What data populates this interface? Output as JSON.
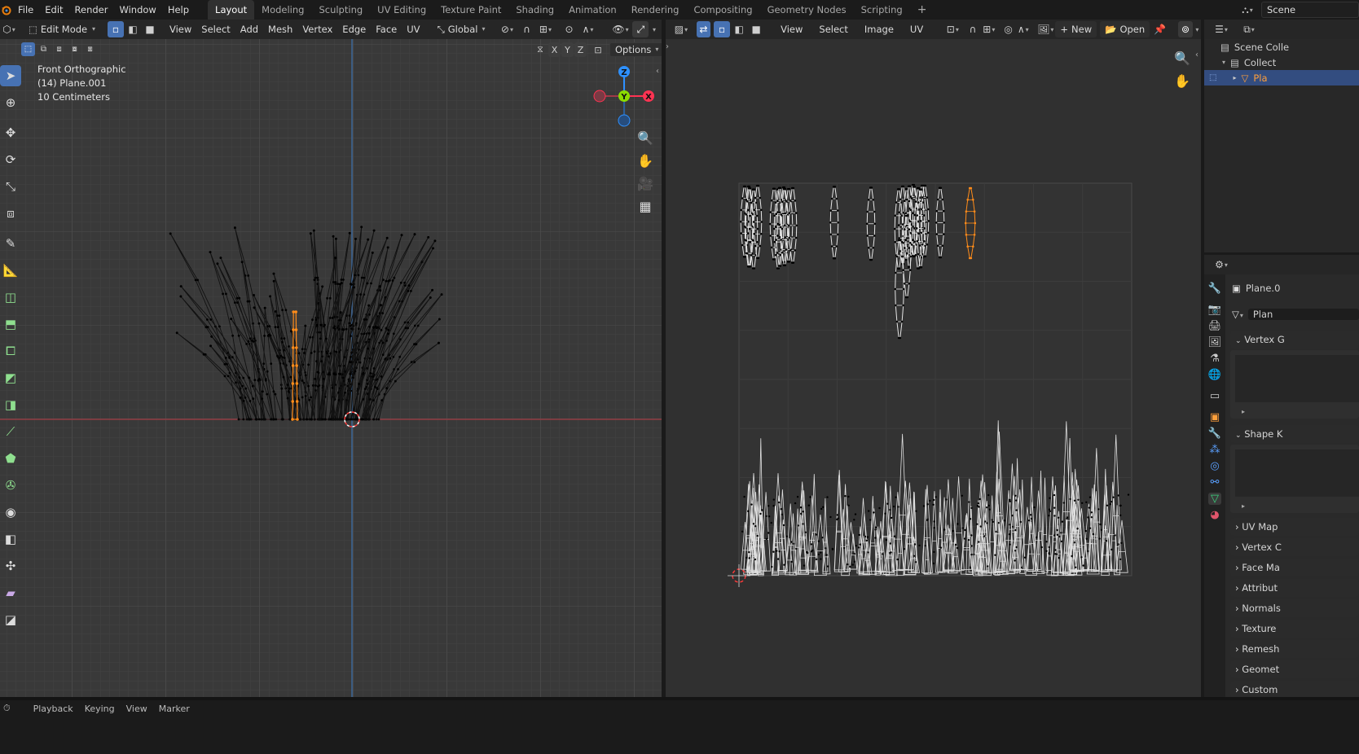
{
  "menus": [
    "File",
    "Edit",
    "Render",
    "Window",
    "Help"
  ],
  "workspaces": [
    "Layout",
    "Modeling",
    "Sculpting",
    "UV Editing",
    "Texture Paint",
    "Shading",
    "Animation",
    "Rendering",
    "Compositing",
    "Geometry Nodes",
    "Scripting"
  ],
  "active_workspace": "Layout",
  "scene_name": "Scene",
  "viewport": {
    "mode": "Edit Mode",
    "menus": [
      "View",
      "Select",
      "Add",
      "Mesh",
      "Vertex",
      "Edge",
      "Face",
      "UV"
    ],
    "orientation": "Global",
    "options_label": "Options",
    "axes": [
      "X",
      "Y",
      "Z"
    ],
    "overlay": {
      "view_name": "Front Orthographic",
      "object": "(14) Plane.001",
      "scale": "10 Centimeters"
    },
    "gizmo": {
      "z": "Z",
      "y": "Y",
      "x": "X"
    }
  },
  "uv_editor": {
    "menus": [
      "View",
      "Select",
      "Image",
      "UV"
    ],
    "new_label": "New",
    "open_label": "Open"
  },
  "outliner": {
    "items": [
      "Scene Colle",
      "Collect",
      "Pla"
    ]
  },
  "properties": {
    "object_name": "Plane.0",
    "mesh_name": "Plan",
    "panels": [
      "Vertex G",
      "Shape K",
      "UV Map",
      "Vertex C",
      "Face Ma",
      "Attribut",
      "Normals",
      "Texture",
      "Remesh",
      "Geomet",
      "Custom"
    ]
  },
  "statusbar": {
    "items": [
      "Playback",
      "Keying",
      "View",
      "Marker"
    ]
  },
  "colors": {
    "accent": "#4772b3",
    "selected": "#ff8c1a",
    "x_axis": "#ff3352",
    "y_axis": "#8bdc00",
    "z_axis": "#2e90ff"
  }
}
